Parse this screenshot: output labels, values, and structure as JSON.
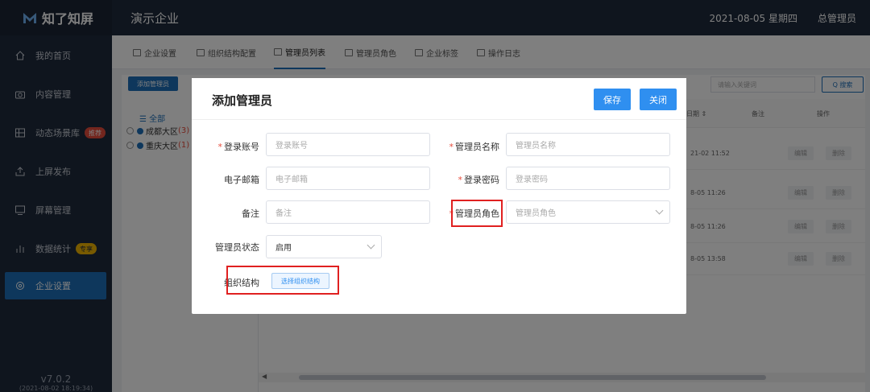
{
  "app": {
    "logo_text": "知了知屏",
    "company": "演示企业",
    "date": "2021-08-05 星期四",
    "user": "总管理员"
  },
  "sidebar": {
    "items": [
      {
        "label": "我的首页",
        "icon": "home-icon"
      },
      {
        "label": "内容管理",
        "icon": "camera-icon"
      },
      {
        "label": "动态场景库",
        "icon": "grid-icon",
        "badge": "推荐"
      },
      {
        "label": "上屏发布",
        "icon": "upload-icon"
      },
      {
        "label": "屏幕管理",
        "icon": "monitor-icon"
      },
      {
        "label": "数据统计",
        "icon": "bar-chart-icon",
        "badge": "专享"
      },
      {
        "label": "企业设置",
        "icon": "gear-icon",
        "active": true
      }
    ],
    "version": "v7.0.2",
    "build": "(2021-08-02 18:19:34)"
  },
  "tabs": [
    {
      "label": "企业设置"
    },
    {
      "label": "组织结构配置"
    },
    {
      "label": "管理员列表",
      "active": true
    },
    {
      "label": "管理员角色"
    },
    {
      "label": "企业标签"
    },
    {
      "label": "操作日志"
    }
  ],
  "toolbar": {
    "add_label": "添加管理员",
    "search_placeholder": "请输入关键词",
    "search_label": "Q 搜索"
  },
  "tree": {
    "all_label": "☰ 全部",
    "nodes": [
      {
        "name": "成都大区",
        "count": "(3)"
      },
      {
        "name": "重庆大区",
        "count": "(1)"
      }
    ]
  },
  "table": {
    "headers": {
      "date": "日期 ⇕",
      "note": "备注",
      "action": "操作"
    },
    "rows": [
      {
        "time": "21-02 11:52",
        "edit": "编辑",
        "delete": "删除"
      },
      {
        "time": "8-05 11:26",
        "edit": "编辑",
        "delete": "删除"
      },
      {
        "time": "8-05 11:26",
        "edit": "编辑",
        "delete": "删除"
      },
      {
        "time": "8-05 13:58",
        "edit": "编辑",
        "delete": "删除"
      }
    ]
  },
  "modal": {
    "title": "添加管理员",
    "save_label": "保存",
    "close_label": "关闭",
    "fields": {
      "account": {
        "label": "登录账号",
        "placeholder": "登录账号"
      },
      "name": {
        "label": "管理员名称",
        "placeholder": "管理员名称"
      },
      "email": {
        "label": "电子邮箱",
        "placeholder": "电子邮箱"
      },
      "password": {
        "label": "登录密码",
        "placeholder": "登录密码"
      },
      "note": {
        "label": "备注",
        "placeholder": "备注"
      },
      "role": {
        "label": "管理员角色",
        "placeholder": "管理员角色"
      },
      "status": {
        "label": "管理员状态",
        "value": "启用"
      },
      "org": {
        "label": "组织结构",
        "button": "选择组织结构"
      }
    },
    "required_mark": "*"
  },
  "colors": {
    "accent": "#1d6fb8",
    "button": "#2f8ff0",
    "highlight": "#e02020",
    "sidebar": "#1f2a3c"
  }
}
